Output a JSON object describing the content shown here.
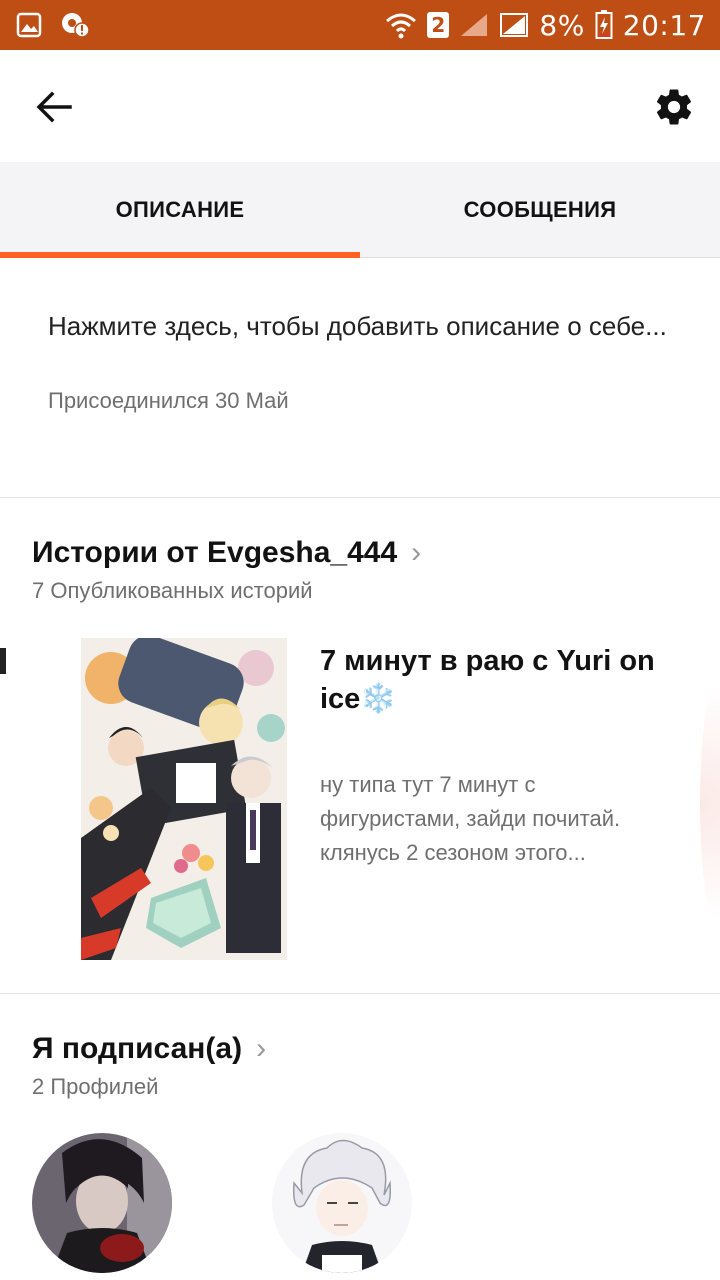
{
  "status_bar": {
    "sim_number": "2",
    "battery": "8%",
    "time": "20:17",
    "icons": [
      "gallery-icon",
      "alert-icon",
      "wifi-icon",
      "signal-icon",
      "battery-charging-icon"
    ]
  },
  "toolbar": {
    "back_icon": "arrow-left-icon",
    "settings_icon": "gear-icon"
  },
  "tabs": [
    {
      "label": "ОПИСАНИЕ",
      "active": true
    },
    {
      "label": "СООБЩЕНИЯ",
      "active": false
    }
  ],
  "profile": {
    "description_prompt": "Нажмите здесь, чтобы добавить описание о себе...",
    "joined": "Присоединился 30 Май"
  },
  "stories": {
    "title": "Истории от Evgesha_444",
    "count_text": "7 Опубликованных историй",
    "items": [
      {
        "title": "7 минут в раю с Yuri on ice❄️",
        "description": "ну типа тут 7 минут с фигуристами, зайди почитай. клянусь 2 сезоном этого..."
      }
    ]
  },
  "following": {
    "title": "Я подписан(а)",
    "count_text": "2 Профилей"
  },
  "colors": {
    "status_bar": "#bf4e14",
    "accent": "#ff6122",
    "tab_bg": "#f4f4f6",
    "secondary_text": "#6f6f6f"
  }
}
